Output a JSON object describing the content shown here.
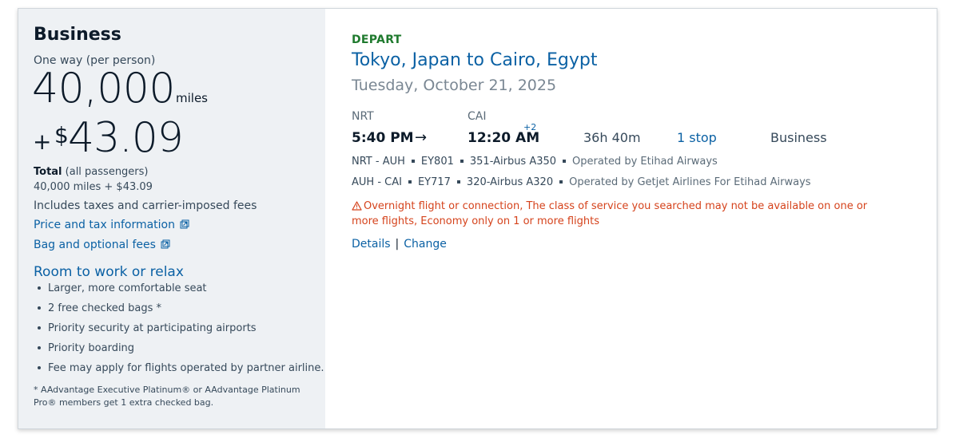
{
  "fare": {
    "cabin": "Business",
    "trip_type": "One way (per person)",
    "miles": "40,000",
    "miles_unit": "miles",
    "plus": "+",
    "currency_symbol": "$",
    "amount": "43.09",
    "total_label": "Total",
    "total_suffix": "(all passengers)",
    "total_value": "40,000 miles + $43.09",
    "includes": "Includes taxes and carrier-imposed fees",
    "price_tax_link": "Price and tax information",
    "bag_fees_link": "Bag and optional fees"
  },
  "perks": {
    "title": "Room to work or relax",
    "items": [
      "Larger, more comfortable seat",
      "2 free checked bags *",
      "Priority security at participating airports",
      "Priority boarding",
      "Fee may apply for flights operated by partner airline."
    ],
    "footnote": "* AAdvantage Executive Platinum® or AAdvantage Platinum Pro® members get 1 extra checked bag."
  },
  "flight": {
    "label": "DEPART",
    "route": "Tokyo, Japan to Cairo, Egypt",
    "date": "Tuesday, October 21, 2025",
    "origin_code": "NRT",
    "dest_code": "CAI",
    "depart_time": "5:40 PM",
    "arrive_time": "12:20 AM",
    "day_offset": "+2",
    "duration": "36h 40m",
    "stops": "1 stop",
    "cabin": "Business",
    "segments": [
      {
        "route": "NRT - AUH",
        "flight": "EY801",
        "aircraft": "351-Airbus A350",
        "operator": "Operated by Etihad Airways"
      },
      {
        "route": "AUH - CAI",
        "flight": "EY717",
        "aircraft": "320-Airbus A320",
        "operator": "Operated by Getjet Airlines For Etihad Airways"
      }
    ],
    "warning": "Overnight flight or connection, The class of service you searched may not be available on one or more flights, Economy only on 1 or more flights",
    "details_link": "Details",
    "change_link": "Change"
  },
  "colors": {
    "brand_blue": "#0b61a4",
    "depart_green": "#1f7a2e",
    "warning_orange": "#d5431c"
  }
}
